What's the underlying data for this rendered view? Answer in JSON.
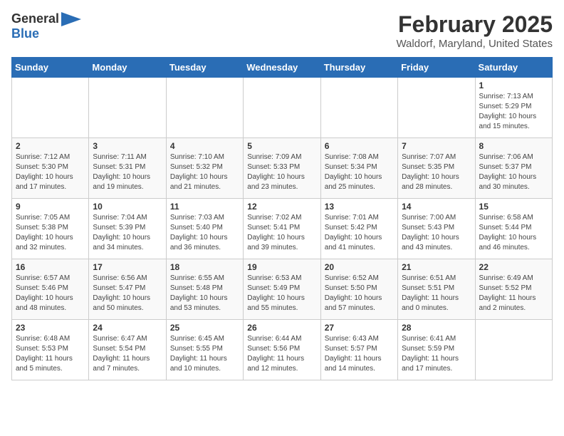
{
  "title": "February 2025",
  "subtitle": "Waldorf, Maryland, United States",
  "logo": {
    "line1": "General",
    "line2": "Blue"
  },
  "days_of_week": [
    "Sunday",
    "Monday",
    "Tuesday",
    "Wednesday",
    "Thursday",
    "Friday",
    "Saturday"
  ],
  "weeks": [
    [
      {
        "day": "",
        "info": ""
      },
      {
        "day": "",
        "info": ""
      },
      {
        "day": "",
        "info": ""
      },
      {
        "day": "",
        "info": ""
      },
      {
        "day": "",
        "info": ""
      },
      {
        "day": "",
        "info": ""
      },
      {
        "day": "1",
        "info": "Sunrise: 7:13 AM\nSunset: 5:29 PM\nDaylight: 10 hours\nand 15 minutes."
      }
    ],
    [
      {
        "day": "2",
        "info": "Sunrise: 7:12 AM\nSunset: 5:30 PM\nDaylight: 10 hours\nand 17 minutes."
      },
      {
        "day": "3",
        "info": "Sunrise: 7:11 AM\nSunset: 5:31 PM\nDaylight: 10 hours\nand 19 minutes."
      },
      {
        "day": "4",
        "info": "Sunrise: 7:10 AM\nSunset: 5:32 PM\nDaylight: 10 hours\nand 21 minutes."
      },
      {
        "day": "5",
        "info": "Sunrise: 7:09 AM\nSunset: 5:33 PM\nDaylight: 10 hours\nand 23 minutes."
      },
      {
        "day": "6",
        "info": "Sunrise: 7:08 AM\nSunset: 5:34 PM\nDaylight: 10 hours\nand 25 minutes."
      },
      {
        "day": "7",
        "info": "Sunrise: 7:07 AM\nSunset: 5:35 PM\nDaylight: 10 hours\nand 28 minutes."
      },
      {
        "day": "8",
        "info": "Sunrise: 7:06 AM\nSunset: 5:37 PM\nDaylight: 10 hours\nand 30 minutes."
      }
    ],
    [
      {
        "day": "9",
        "info": "Sunrise: 7:05 AM\nSunset: 5:38 PM\nDaylight: 10 hours\nand 32 minutes."
      },
      {
        "day": "10",
        "info": "Sunrise: 7:04 AM\nSunset: 5:39 PM\nDaylight: 10 hours\nand 34 minutes."
      },
      {
        "day": "11",
        "info": "Sunrise: 7:03 AM\nSunset: 5:40 PM\nDaylight: 10 hours\nand 36 minutes."
      },
      {
        "day": "12",
        "info": "Sunrise: 7:02 AM\nSunset: 5:41 PM\nDaylight: 10 hours\nand 39 minutes."
      },
      {
        "day": "13",
        "info": "Sunrise: 7:01 AM\nSunset: 5:42 PM\nDaylight: 10 hours\nand 41 minutes."
      },
      {
        "day": "14",
        "info": "Sunrise: 7:00 AM\nSunset: 5:43 PM\nDaylight: 10 hours\nand 43 minutes."
      },
      {
        "day": "15",
        "info": "Sunrise: 6:58 AM\nSunset: 5:44 PM\nDaylight: 10 hours\nand 46 minutes."
      }
    ],
    [
      {
        "day": "16",
        "info": "Sunrise: 6:57 AM\nSunset: 5:46 PM\nDaylight: 10 hours\nand 48 minutes."
      },
      {
        "day": "17",
        "info": "Sunrise: 6:56 AM\nSunset: 5:47 PM\nDaylight: 10 hours\nand 50 minutes."
      },
      {
        "day": "18",
        "info": "Sunrise: 6:55 AM\nSunset: 5:48 PM\nDaylight: 10 hours\nand 53 minutes."
      },
      {
        "day": "19",
        "info": "Sunrise: 6:53 AM\nSunset: 5:49 PM\nDaylight: 10 hours\nand 55 minutes."
      },
      {
        "day": "20",
        "info": "Sunrise: 6:52 AM\nSunset: 5:50 PM\nDaylight: 10 hours\nand 57 minutes."
      },
      {
        "day": "21",
        "info": "Sunrise: 6:51 AM\nSunset: 5:51 PM\nDaylight: 11 hours\nand 0 minutes."
      },
      {
        "day": "22",
        "info": "Sunrise: 6:49 AM\nSunset: 5:52 PM\nDaylight: 11 hours\nand 2 minutes."
      }
    ],
    [
      {
        "day": "23",
        "info": "Sunrise: 6:48 AM\nSunset: 5:53 PM\nDaylight: 11 hours\nand 5 minutes."
      },
      {
        "day": "24",
        "info": "Sunrise: 6:47 AM\nSunset: 5:54 PM\nDaylight: 11 hours\nand 7 minutes."
      },
      {
        "day": "25",
        "info": "Sunrise: 6:45 AM\nSunset: 5:55 PM\nDaylight: 11 hours\nand 10 minutes."
      },
      {
        "day": "26",
        "info": "Sunrise: 6:44 AM\nSunset: 5:56 PM\nDaylight: 11 hours\nand 12 minutes."
      },
      {
        "day": "27",
        "info": "Sunrise: 6:43 AM\nSunset: 5:57 PM\nDaylight: 11 hours\nand 14 minutes."
      },
      {
        "day": "28",
        "info": "Sunrise: 6:41 AM\nSunset: 5:59 PM\nDaylight: 11 hours\nand 17 minutes."
      },
      {
        "day": "",
        "info": ""
      }
    ]
  ]
}
